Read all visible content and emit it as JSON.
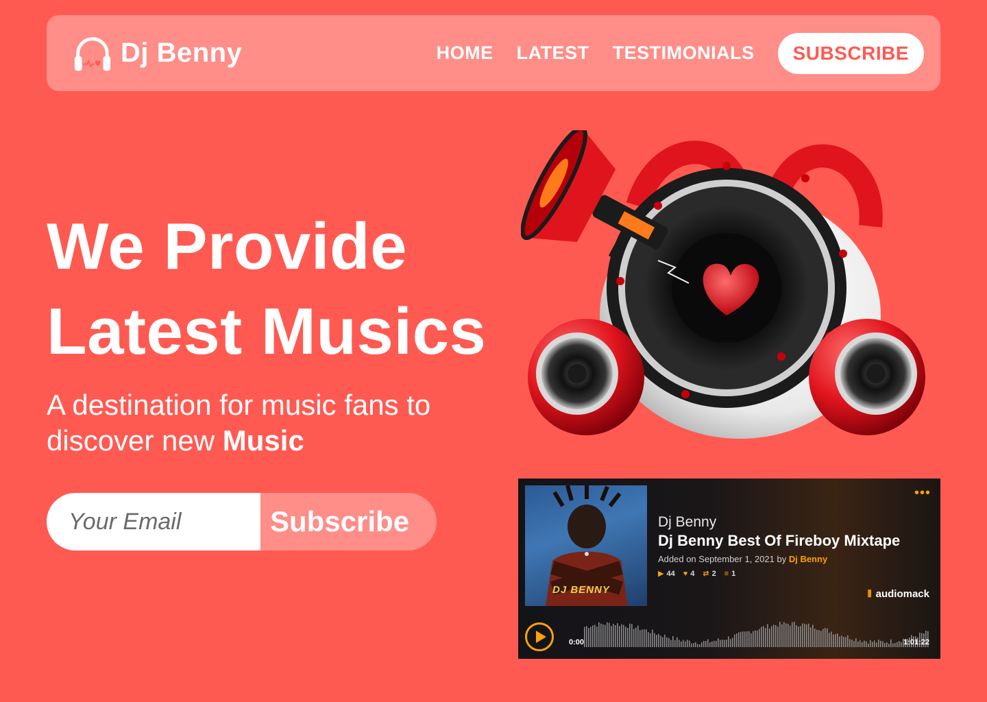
{
  "brand": {
    "name": "Dj Benny",
    "logo_icon": "headphones-heart-icon"
  },
  "nav": {
    "links": [
      {
        "label": "HOME"
      },
      {
        "label": "LATEST"
      },
      {
        "label": "TESTIMONIALS"
      }
    ],
    "subscribe_label": "SUBSCRIBE"
  },
  "hero": {
    "title_line1": "We Provide",
    "title_line2": "Latest Musics",
    "subtitle_prefix": "A destination for music fans to discover new",
    "subtitle_bold": "Music"
  },
  "email_form": {
    "placeholder": "Your Email",
    "button_label": "Subscribe"
  },
  "player": {
    "artist": "Dj Benny",
    "title": "Dj Benny Best Of Fireboy Mixtape",
    "added_prefix": "Added on September 1, 2021 by",
    "added_by": "Dj Benny",
    "cover_text": "DJ BENNY",
    "stats": {
      "plays": "44",
      "likes": "4",
      "reposts": "2",
      "playlists": "1"
    },
    "brand": "audiomack",
    "time_start": "0:00",
    "time_end": "1:01:22",
    "accent": "#ffa200"
  },
  "colors": {
    "background": "#ff5a52",
    "navbar": "#ff8d88",
    "accent": "#ff5a52"
  }
}
